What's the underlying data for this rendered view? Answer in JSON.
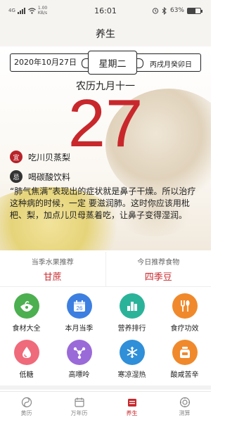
{
  "status_bar": {
    "network": "4G",
    "speed_value": "1.00",
    "speed_unit": "KB/s",
    "time": "16:01",
    "battery": "63%",
    "battery_level": 0.63
  },
  "header": {
    "title": "养生"
  },
  "hero": {
    "solar_date": "2020年10月27日",
    "weekday": "星期二",
    "ganzhi": "丙戌月癸卯日",
    "lunar_date": "农历九月十一",
    "day": "27",
    "yi_icon": "宜",
    "yi_text": "吃川贝蒸梨",
    "ji_icon": "忌",
    "ji_text": "喝碳酸饮料",
    "description": "“肺气焦满”表现出的症状就是鼻子干燥。所以治疗这种病的时候，一定 要滋润肺。这时你应该用枇杷、梨，加点儿贝母蒸着吃，让鼻子变得湿润。"
  },
  "recommend": {
    "fruit_label": "当季水果推荐",
    "fruit_value": "甘蔗",
    "food_label": "今日推荐食物",
    "food_value": "四季豆"
  },
  "grid": {
    "items": [
      {
        "label": "食材大全",
        "icon": "vegetables-icon",
        "color": "#4caf50"
      },
      {
        "label": "本月当季",
        "icon": "calendar-icon",
        "color": "#3d7fe0"
      },
      {
        "label": "营养排行",
        "icon": "bar-chart-icon",
        "color": "#2bb39a"
      },
      {
        "label": "食疗功效",
        "icon": "fork-spoon-icon",
        "color": "#f0892b"
      },
      {
        "label": "低糖",
        "icon": "drop-icon",
        "color": "#ef6a7a"
      },
      {
        "label": "高嘌呤",
        "icon": "molecule-icon",
        "color": "#9a6ad8"
      },
      {
        "label": "寒凉湿热",
        "icon": "snowflake-icon",
        "color": "#2f8fd8"
      },
      {
        "label": "酸咸苦辛",
        "icon": "jar-icon",
        "color": "#f0892b"
      }
    ],
    "calendar_number": "26"
  },
  "tabbar": {
    "tabs": [
      {
        "label": "黄历",
        "icon": "almanac-icon",
        "active": false
      },
      {
        "label": "万年历",
        "icon": "calendar-tab-icon",
        "active": false
      },
      {
        "label": "养生",
        "icon": "health-icon",
        "active": true
      },
      {
        "label": "测算",
        "icon": "fortune-icon",
        "active": false
      }
    ]
  },
  "colors": {
    "accent": "#c8282c",
    "header_bg": "#f6f4f1"
  }
}
